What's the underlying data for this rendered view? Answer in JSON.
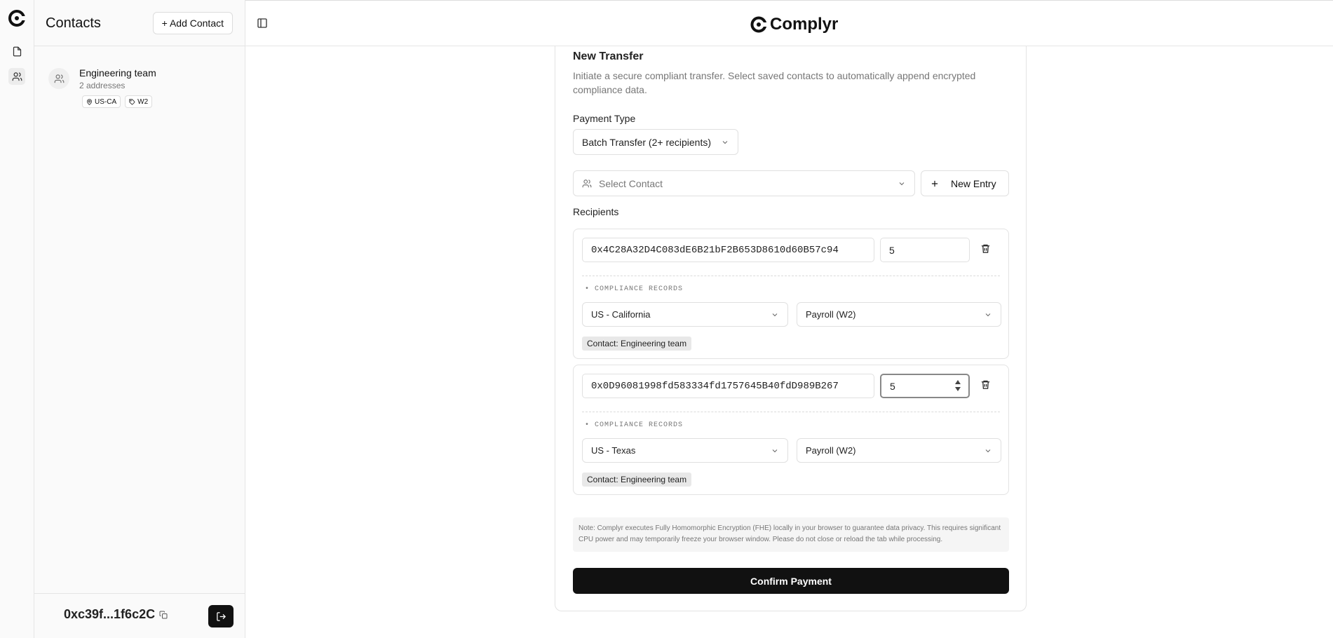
{
  "app": {
    "brand": "Complyr"
  },
  "rail": {
    "icons": [
      "complyr-logo",
      "document-icon",
      "users-icon"
    ]
  },
  "contacts": {
    "title": "Contacts",
    "add_button": "+ Add Contact",
    "items": [
      {
        "name": "Engineering team",
        "subtitle": "2 addresses",
        "tags": [
          "US-CA",
          "W2"
        ]
      }
    ],
    "wallet": "0xc39f...1f6c2C"
  },
  "transfer": {
    "title": "New Transfer",
    "description": "Initiate a secure compliant transfer. Select saved contacts to automatically append encrypted compliance data.",
    "payment_type_label": "Payment Type",
    "payment_type_value": "Batch Transfer (2+ recipients)",
    "select_contact_placeholder": "Select Contact",
    "new_entry_label": "New Entry",
    "recipients_label": "Recipients",
    "compliance_label": "COMPLIANCE RECORDS",
    "recipients": [
      {
        "address": "0x4C28A32D4C083dE6B21bF2B653D8610d60B57c94",
        "amount": "5",
        "region": "US - California",
        "category": "Payroll (W2)",
        "contact": "Contact: Engineering team"
      },
      {
        "address": "0x0D96081998fd583334fd1757645B40fdD989B267",
        "amount": "5",
        "region": "US - Texas",
        "category": "Payroll (W2)",
        "contact": "Contact: Engineering team"
      }
    ],
    "note": "Note: Complyr executes Fully Homomorphic Encryption (FHE) locally in your browser to guarantee data privacy. This requires significant CPU power and may temporarily freeze your browser window. Please do not close or reload the tab while processing.",
    "confirm_label": "Confirm Payment"
  }
}
